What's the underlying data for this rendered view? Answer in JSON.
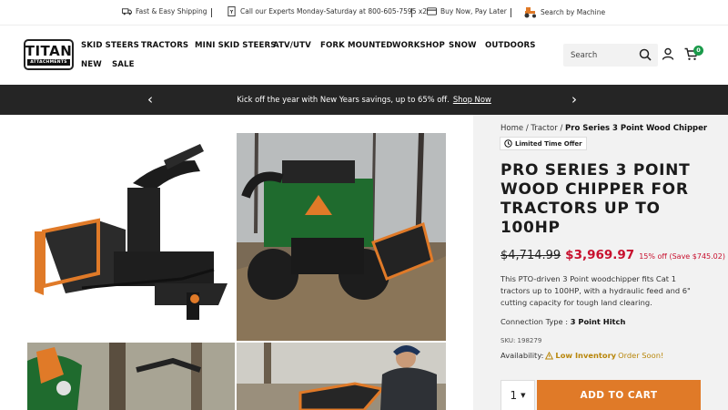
{
  "utility": {
    "shipping": "Fast & Easy Shipping",
    "experts": "Call our Experts Monday-Saturday at 800-605-7595 x2",
    "financing": "Buy Now, Pay Later",
    "machine": "Search by Machine"
  },
  "logo": {
    "main": "TITAN",
    "sub": "ATTACHMENTS"
  },
  "nav": {
    "items": [
      "SKID STEERS",
      "TRACTORS",
      "MINI SKID STEERS",
      "ATV/UTV",
      "FORK MOUNTED",
      "WORKSHOP",
      "SNOW",
      "OUTDOORS",
      "NEW",
      "SALE"
    ]
  },
  "search": {
    "placeholder": "Search"
  },
  "cart": {
    "count": "0"
  },
  "promo": {
    "text": "Kick off the year with New Years savings, up to 65% off.",
    "link": "Shop Now",
    "prev": "‹",
    "next": "›"
  },
  "product": {
    "breadcrumb_home": "Home",
    "breadcrumb_sep1": "/",
    "breadcrumb_cat": "Tractor",
    "breadcrumb_sep2": "/",
    "breadcrumb_current": "Pro Series 3 Point Wood Chipper",
    "badge": "Limited Time Offer",
    "title": "PRO SERIES 3 POINT WOOD CHIPPER FOR TRACTORS UP TO 100HP",
    "old_price": "$4,714.99",
    "new_price": "$3,969.97",
    "savings": "15% off (Save $745.02)",
    "description": "This PTO-driven 3 Point woodchipper fits Cat 1 tractors up to 100HP, with a hydraulic feed and 6\" cutting capacity for tough land clearing.",
    "connection_label": "Connection Type :",
    "connection_value": "3 Point Hitch",
    "sku": "SKU: 198279",
    "availability_label": "Availability:",
    "availability_status": "Low Inventory",
    "availability_note": "Order Soon!",
    "quantity": "1",
    "add_to_cart": "ADD TO CART"
  },
  "colors": {
    "promo_bg": "#252525",
    "sale_red": "#c8102e",
    "cta_orange": "#e07a28",
    "badge_green": "#1a9a4a",
    "warning_gold": "#b8860b"
  }
}
